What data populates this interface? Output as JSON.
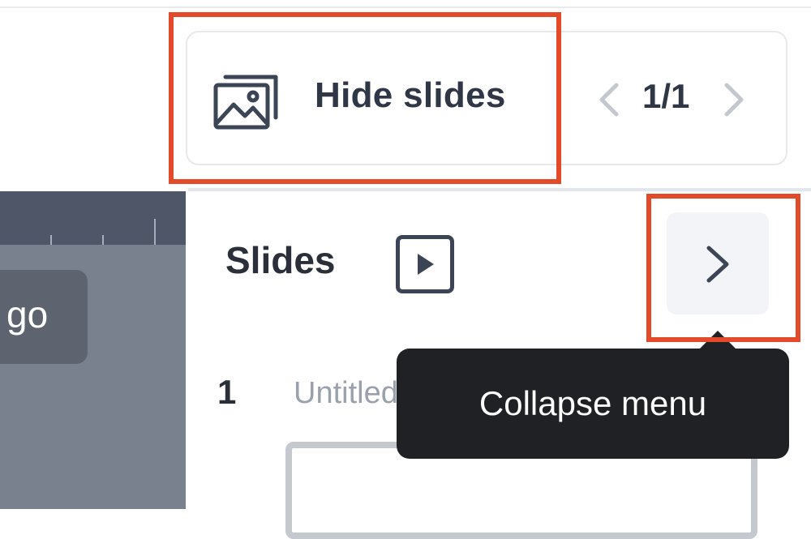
{
  "toolbar": {
    "hide_slides_label": "Hide slides",
    "page_indicator": "1/1",
    "prev_icon": "chevron-left-icon",
    "next_icon": "chevron-right-icon",
    "image_icon": "images-icon"
  },
  "canvas": {
    "chip_text": "go"
  },
  "slides_panel": {
    "title": "Slides",
    "play_icon": "play-icon",
    "collapse_icon": "chevron-right-icon",
    "items": [
      {
        "number": "1",
        "name": "Untitled"
      }
    ]
  },
  "tooltip": {
    "text": "Collapse menu"
  },
  "colors": {
    "highlight": "#e24a2a",
    "text_dark": "#2f3747",
    "canvas_bg": "#79808e",
    "tooltip_bg": "#1f2124"
  }
}
